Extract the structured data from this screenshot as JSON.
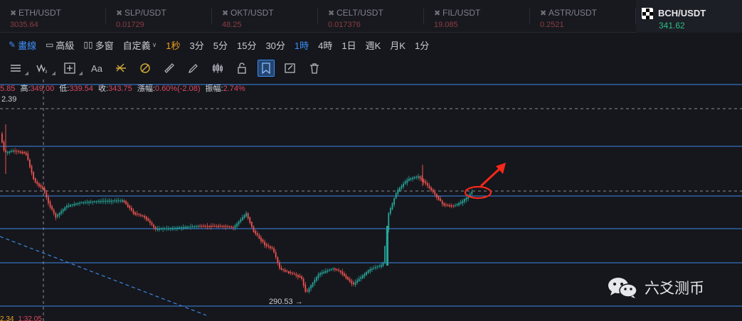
{
  "tickers": [
    {
      "symbol": "ETH/USDT",
      "price": "3035.64"
    },
    {
      "symbol": "SLP/USDT",
      "price": "0.01729"
    },
    {
      "symbol": "OKT/USDT",
      "price": "48.25"
    },
    {
      "symbol": "CELT/USDT",
      "price": "0.017376"
    },
    {
      "symbol": "FIL/USDT",
      "price": "19.085"
    },
    {
      "symbol": "ASTR/USDT",
      "price": "0.2521"
    },
    {
      "symbol": "BCH/USDT",
      "price": "341.62",
      "active": true
    }
  ],
  "timeframes": {
    "draw": "畫線",
    "advanced": "高級",
    "multi": "多窗",
    "custom": "自定義",
    "sec1": "1秒",
    "m3": "3分",
    "m5": "5分",
    "m15": "15分",
    "m30": "30分",
    "h1": "1時",
    "h4": "4時",
    "d1": "1日",
    "w1": "週K",
    "mo1": "月K",
    "m1": "1分"
  },
  "toolbar": {
    "text_tool": "Aa",
    "icons": [
      "horizontal-lines-icon",
      "wave-icon",
      "crosshair-icon",
      "text-icon",
      "fib-icon",
      "fib-circle-icon",
      "ruler-icon",
      "brush-icon",
      "candles-icon",
      "lock-icon",
      "bookmark-icon",
      "edit-icon",
      "trash-icon"
    ]
  },
  "ohlc": {
    "open_value": "5.85",
    "high_label": "高:",
    "high_value": "349.00",
    "low_label": "低:",
    "low_value": "339.54",
    "close_label": "收:",
    "close_value": "343.75",
    "change_label": "漲幅:",
    "change_value": "0.60%(-2.08)",
    "amp_label": "振幅:",
    "amp_value": "2.74%"
  },
  "chart": {
    "price_label_top": "2.39",
    "low_marker": "290.53 →",
    "footer_left": "2.34",
    "footer_right": "1:32.05",
    "colors": {
      "up": "#26a69a",
      "down": "#ef5350",
      "hline": "#3f86e8",
      "annotation": "#f5281a"
    }
  },
  "watermark": {
    "text": "六爻测币"
  }
}
